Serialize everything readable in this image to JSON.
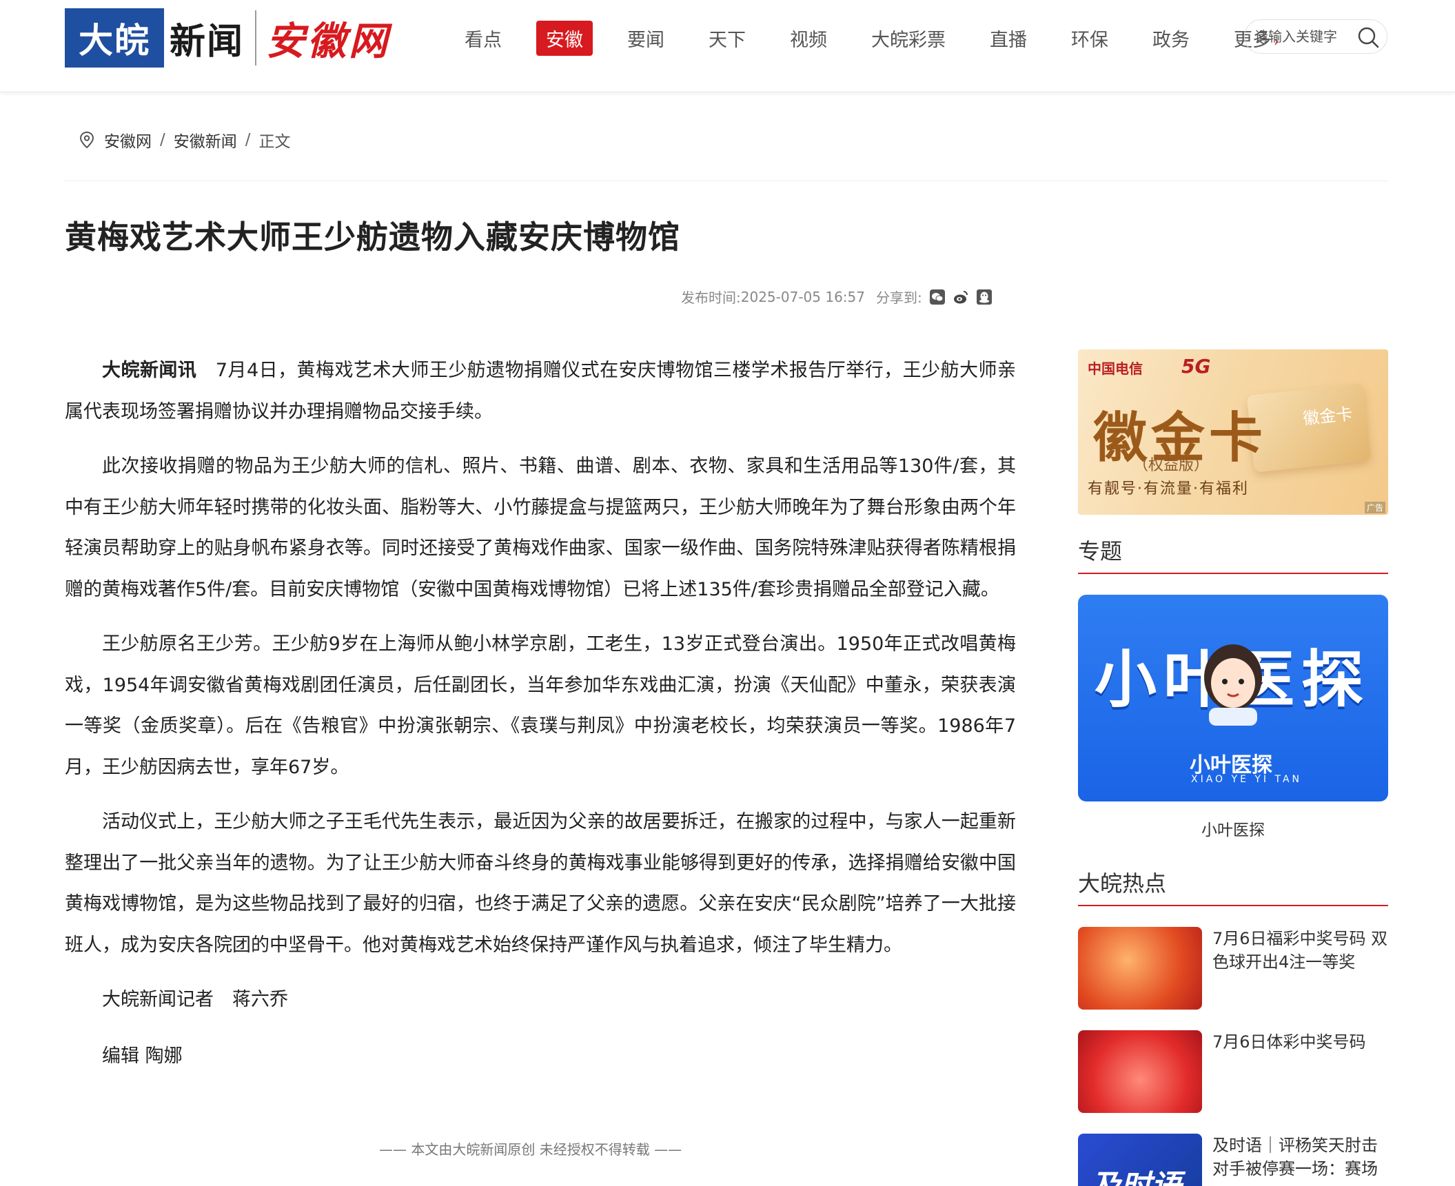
{
  "header": {
    "logo_box": "大皖",
    "logo_text": "新闻",
    "logo_script": "安徽网",
    "nav": [
      "看点",
      "安徽",
      "要闻",
      "天下",
      "视频",
      "大皖彩票",
      "直播",
      "环保",
      "政务",
      "更多"
    ],
    "nav_active": "安徽",
    "more_arrow": "›",
    "search_placeholder": "请输入关键字"
  },
  "breadcrumb": {
    "items": [
      "安徽网",
      "安徽新闻",
      "正文"
    ],
    "separator": "/"
  },
  "article": {
    "title": "黄梅戏艺术大师王少舫遗物入藏安庆博物馆",
    "publish_label": "发布时间:",
    "publish_time": "2025-07-05 16:57",
    "share_label": "分享到:",
    "share_icons": [
      "wechat-icon",
      "weibo-icon",
      "qq-icon"
    ],
    "lead": "大皖新闻讯",
    "paragraphs": [
      "7月4日，黄梅戏艺术大师王少舫遗物捐赠仪式在安庆博物馆三楼学术报告厅举行，王少舫大师亲属代表现场签署捐赠协议并办理捐赠物品交接手续。",
      "此次接收捐赠的物品为王少舫大师的信札、照片、书籍、曲谱、剧本、衣物、家具和生活用品等130件/套，其中有王少舫大师年轻时携带的化妆头面、脂粉等大、小竹藤提盒与提篮两只，王少舫大师晚年为了舞台形象由两个年轻演员帮助穿上的贴身帆布紧身衣等。同时还接受了黄梅戏作曲家、国家一级作曲、国务院特殊津贴获得者陈精根捐赠的黄梅戏著作5件/套。目前安庆博物馆（安徽中国黄梅戏博物馆）已将上述135件/套珍贵捐赠品全部登记入藏。",
      "王少舫原名王少芳。王少舫9岁在上海师从鲍小林学京剧，工老生，13岁正式登台演出。1950年正式改唱黄梅戏，1954年调安徽省黄梅戏剧团任演员，后任副团长，当年参加华东戏曲汇演，扮演《天仙配》中董永，荣获表演一等奖（金质奖章）。后在《告粮官》中扮演张朝宗、《袁璞与荆凤》中扮演老校长，均荣获演员一等奖。1986年7月，王少舫因病去世，享年67岁。",
      "活动仪式上，王少舫大师之子王毛代先生表示，最近因为父亲的故居要拆迁，在搬家的过程中，与家人一起重新整理出了一批父亲当年的遗物。为了让王少舫大师奋斗终身的黄梅戏事业能够得到更好的传承，选择捐赠给安徽中国黄梅戏博物馆，是为这些物品找到了最好的归宿，也终于满足了父亲的遗愿。父亲在安庆“民众剧院”培养了一大批接班人，成为安庆各院团的中坚骨干。他对黄梅戏艺术始终保持严谨作风与执着追求，倾注了毕生精力。"
    ],
    "reporter": "大皖新闻记者　蒋六乔",
    "editor": "编辑 陶娜",
    "footer_note": "—— 本文由大皖新闻原创 未经授权不得转载 ——"
  },
  "sidebar": {
    "ad": {
      "brand": "中国电信",
      "badge": "5G",
      "title": "徽金卡",
      "subtitle": "（权益版）",
      "tagline": "有靓号·有流量·有福利",
      "card_text": "徽金卡",
      "ad_label": "广告"
    },
    "topics_title": "专题",
    "topic": {
      "big_text": "小叶医探",
      "logo_text": "小叶医探",
      "logo_en": "XIAO YE YI TAN",
      "caption": "小叶医探"
    },
    "hot_title": "大皖热点",
    "hot_items": [
      "7月6日福彩中奖号码 双色球开出4注一等奖",
      "7月6日体彩中奖号码",
      "及时语｜评杨笑天肘击对手被停赛一场：赛场"
    ],
    "hot3_img_text": "及时语"
  },
  "colors": {
    "accent": "#d71a1f",
    "logo_blue": "#1f4fa0",
    "topic_blue": "#2f7df2"
  }
}
